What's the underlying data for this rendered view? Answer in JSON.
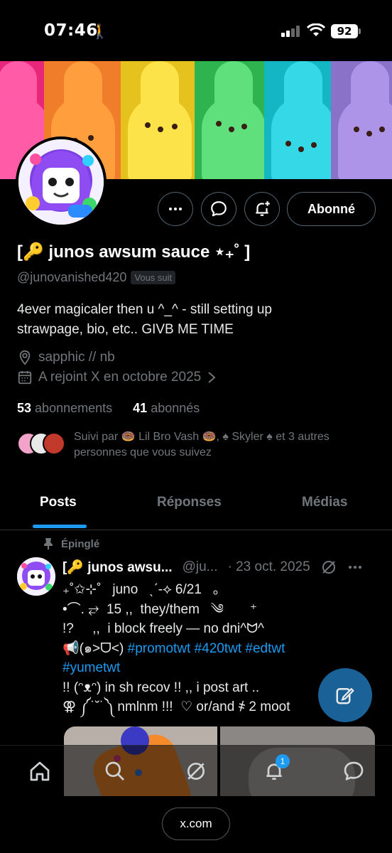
{
  "status_bar": {
    "time": "07:46",
    "battery": "92"
  },
  "profile": {
    "display_name": "[⸗⊕ junos awsum sauce ⋆⁺₊˚ ]",
    "display_name_text": "[🔑 junos awsum sauce ⋆₊˚ ]",
    "handle": "@junovanished420",
    "follows_you": "Vous suit",
    "bio_line1": "4ever magicaler then u ^_^ - still setting up",
    "bio_line2": "strawpage, bio, etc.. GIVB ME TIME",
    "location": "sapphic // nb",
    "joined": "A rejoint X en octobre 2025",
    "following_count": "53",
    "following_label": "abonnements",
    "followers_count": "41",
    "followers_label": "abonnés",
    "followed_by": "Suivi par 🍩 Lil Bro Vash 🍩, ♠ Skyler ♠ et 3 autres personnes que vous suivez",
    "follow_button": "Abonné"
  },
  "tabs": [
    "Posts",
    "Réponses",
    "Médias"
  ],
  "pinned_post": {
    "pinned_label": "Épinglé",
    "author_name": "[🔑 junos awsu...",
    "author_handle": "@ju...",
    "date": "· 23 oct. 2025",
    "line1": "₊˚✩⊹˚   juno   ˎˊ-⟡ 6/21   。",
    "line2": "•⌒. ⥂  15 ,,  they/them   ༄       ⁺",
    "line3": "!?     ,,  i block freely — no dni^ᗢ^",
    "line4_prefix": "📢(๑˃ᗜ˂)",
    "line4_tags": " #promotwt #420twt #edtwt",
    "line5_tags": "#yumetwt",
    "line6": "!! (ᵔᴥᵔ) in sh recov !! ,, i post art ..",
    "line7": "⚢ ༼˙˘˙༽ nmlnm !!!  ♡ or/and ҂ 2 moot"
  },
  "browser": {
    "url": "x.com"
  },
  "notifications_badge": "1",
  "colors": {
    "accent": "#1d9bf0",
    "background": "#000000",
    "muted_text": "#71767b"
  }
}
